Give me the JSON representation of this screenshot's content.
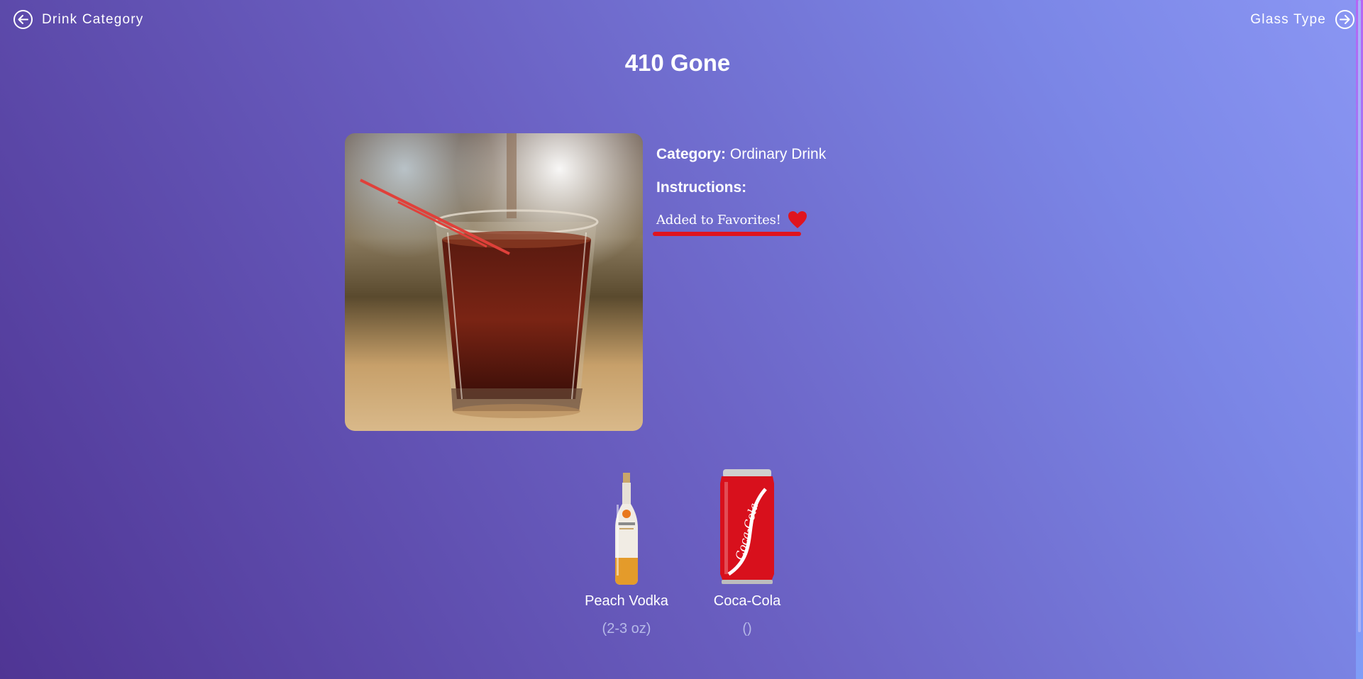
{
  "nav": {
    "prev_label": "Drink Category",
    "prev_icon": "arrow-left-circle-icon",
    "next_label": "Glass Type",
    "next_icon": "arrow-right-circle-icon"
  },
  "drink": {
    "title": "410 Gone",
    "category_label": "Category:",
    "category_value": "Ordinary Drink",
    "instructions_label": "Instructions:",
    "favorite_text": "Added to Favorites!",
    "favorite_icon": "heart-icon",
    "favorite_color": "#e0141e"
  },
  "ingredients": [
    {
      "name": "Peach Vodka",
      "measure": "(2-3 oz)",
      "icon": "vodka-bottle-image"
    },
    {
      "name": "Coca-Cola",
      "measure": "()",
      "icon": "cola-can-image"
    }
  ]
}
